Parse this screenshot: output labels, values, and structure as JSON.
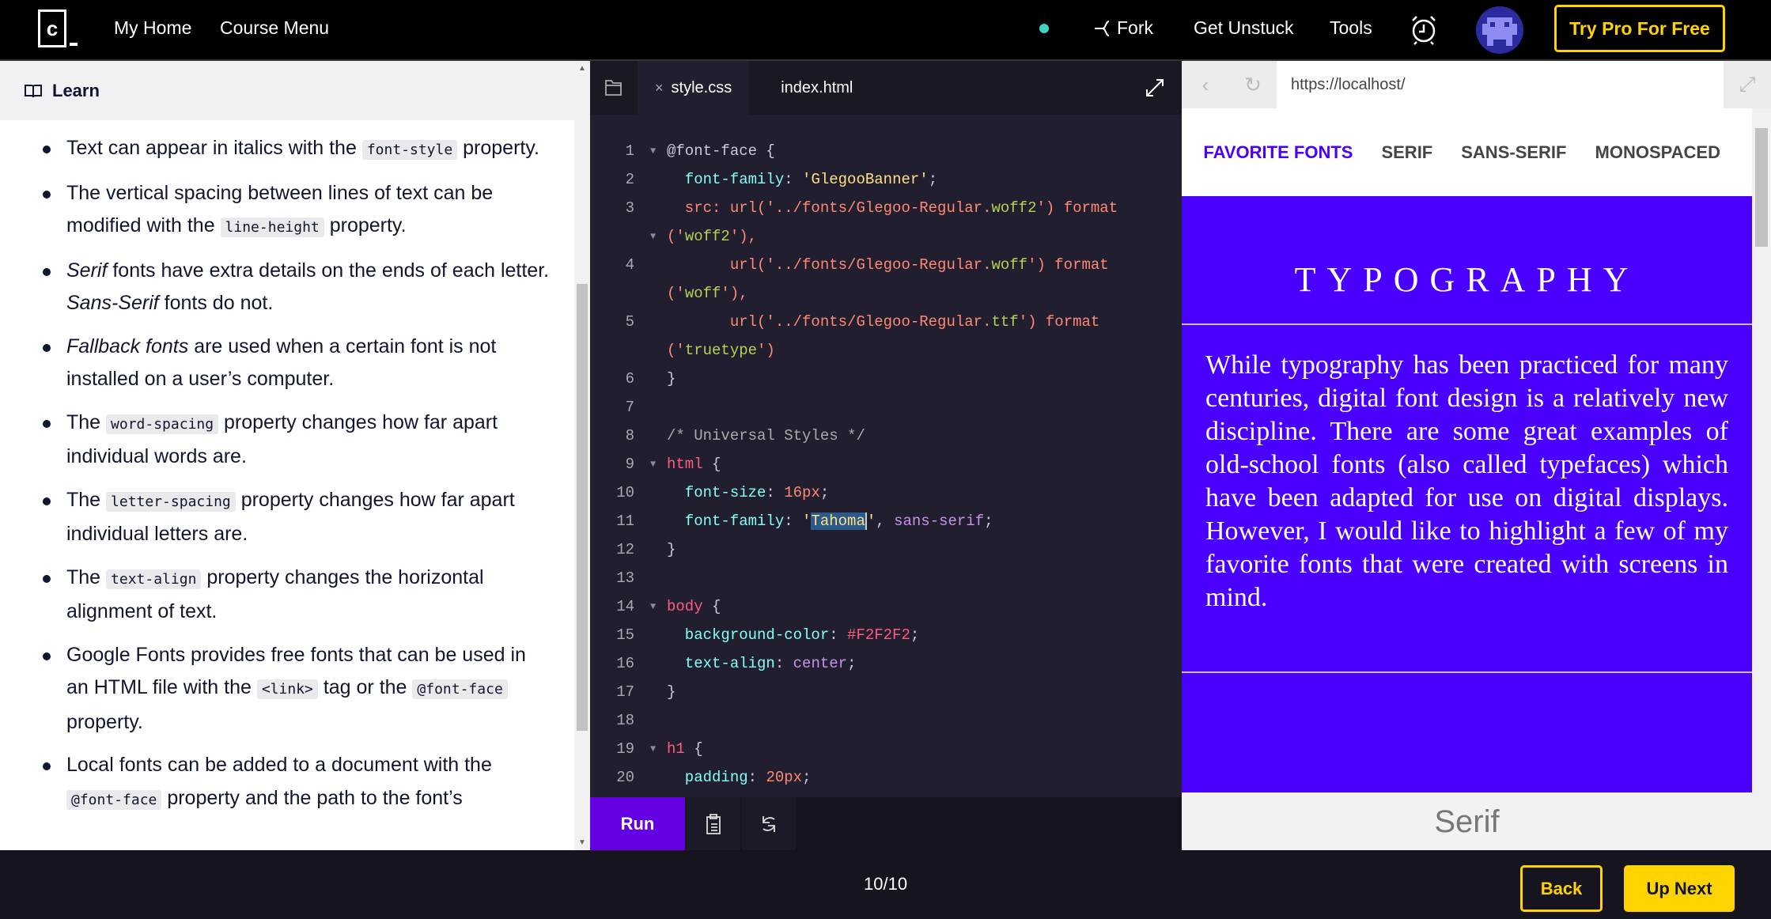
{
  "topbar": {
    "logo_letter": "c",
    "nav": [
      "My Home",
      "Course Menu"
    ],
    "fork": "Fork",
    "get_unstuck": "Get Unstuck",
    "tools": "Tools",
    "try_pro": "Try Pro For Free"
  },
  "learn": {
    "title": "Learn",
    "items": [
      [
        {
          "t": "text",
          "v": "Text can appear in italics with the "
        },
        {
          "t": "code",
          "v": "font-style"
        },
        {
          "t": "text",
          "v": " property."
        }
      ],
      [
        {
          "t": "text",
          "v": "The vertical spacing between lines of text can be modified with the "
        },
        {
          "t": "code",
          "v": "line-height"
        },
        {
          "t": "text",
          "v": " property."
        }
      ],
      [
        {
          "t": "em",
          "v": "Serif"
        },
        {
          "t": "text",
          "v": " fonts have extra details on the ends of each letter. "
        },
        {
          "t": "em",
          "v": "Sans-Serif"
        },
        {
          "t": "text",
          "v": " fonts do not."
        }
      ],
      [
        {
          "t": "em",
          "v": "Fallback fonts"
        },
        {
          "t": "text",
          "v": " are used when a certain font is not installed on a user’s computer."
        }
      ],
      [
        {
          "t": "text",
          "v": "The "
        },
        {
          "t": "code",
          "v": "word-spacing"
        },
        {
          "t": "text",
          "v": " property changes how far apart individual words are."
        }
      ],
      [
        {
          "t": "text",
          "v": "The "
        },
        {
          "t": "code",
          "v": "letter-spacing"
        },
        {
          "t": "text",
          "v": " property changes how far apart individual letters are."
        }
      ],
      [
        {
          "t": "text",
          "v": "The "
        },
        {
          "t": "code",
          "v": "text-align"
        },
        {
          "t": "text",
          "v": " property changes the horizontal alignment of text."
        }
      ],
      [
        {
          "t": "text",
          "v": "Google Fonts provides free fonts that can be used in an HTML file with the "
        },
        {
          "t": "code",
          "v": "<link>"
        },
        {
          "t": "text",
          "v": " tag or the "
        },
        {
          "t": "code",
          "v": "@font-face"
        },
        {
          "t": "text",
          "v": " property."
        }
      ],
      [
        {
          "t": "text",
          "v": "Local fonts can be added to a document with the "
        },
        {
          "t": "code",
          "v": "@font-face"
        },
        {
          "t": "text",
          "v": " property and the path to the font’s"
        }
      ]
    ]
  },
  "editor": {
    "tabs": [
      "style.css",
      "index.html"
    ],
    "active_tab": "style.css",
    "rows": [
      {
        "n": "1",
        "fold": true,
        "seg": [
          [
            "at",
            "@font-face "
          ],
          [
            "at",
            "{"
          ]
        ]
      },
      {
        "n": "2",
        "seg": [
          [
            "prop",
            "  font-family"
          ],
          [
            "at",
            ": "
          ],
          [
            "str",
            "'GlegooBanner'"
          ],
          [
            "at",
            ";"
          ]
        ]
      },
      {
        "n": "3",
        "seg": [
          [
            "url",
            "  src: url('../fonts/Glegoo-Regular."
          ],
          [
            "kw",
            "woff2"
          ],
          [
            "url",
            "') format"
          ]
        ]
      },
      {
        "n": "",
        "fold": true,
        "seg": [
          [
            "url",
            "('"
          ],
          [
            "kw",
            "woff2"
          ],
          [
            "url",
            "'),"
          ]
        ]
      },
      {
        "n": "4",
        "seg": [
          [
            "url",
            "       url('../fonts/Glegoo-Regular."
          ],
          [
            "kw",
            "woff"
          ],
          [
            "url",
            "') format"
          ]
        ]
      },
      {
        "n": "",
        "seg": [
          [
            "url",
            "('"
          ],
          [
            "kw",
            "woff"
          ],
          [
            "url",
            "'),"
          ]
        ]
      },
      {
        "n": "5",
        "seg": [
          [
            "url",
            "       url('../fonts/Glegoo-Regular."
          ],
          [
            "kw",
            "ttf"
          ],
          [
            "url",
            "') format"
          ]
        ]
      },
      {
        "n": "",
        "seg": [
          [
            "url",
            "('"
          ],
          [
            "kw",
            "truetype"
          ],
          [
            "url",
            "')"
          ]
        ]
      },
      {
        "n": "6",
        "seg": [
          [
            "at",
            "}"
          ]
        ]
      },
      {
        "n": "7",
        "seg": []
      },
      {
        "n": "8",
        "seg": [
          [
            "com",
            "/* Universal Styles */"
          ]
        ]
      },
      {
        "n": "9",
        "fold": true,
        "seg": [
          [
            "sel",
            "html"
          ],
          [
            "at",
            " {"
          ]
        ]
      },
      {
        "n": "10",
        "seg": [
          [
            "prop",
            "  font-size"
          ],
          [
            "at",
            ": "
          ],
          [
            "num",
            "16px"
          ],
          [
            "at",
            ";"
          ]
        ]
      },
      {
        "n": "11",
        "seg": [
          [
            "prop",
            "  font-family"
          ],
          [
            "at",
            ": "
          ],
          [
            "str",
            "'"
          ],
          [
            "strsel",
            "Tahoma"
          ],
          [
            "str",
            "'"
          ],
          [
            "at",
            ", "
          ],
          [
            "val",
            "sans-serif"
          ],
          [
            "at",
            ";"
          ]
        ]
      },
      {
        "n": "12",
        "seg": [
          [
            "at",
            "}"
          ]
        ]
      },
      {
        "n": "13",
        "seg": []
      },
      {
        "n": "14",
        "fold": true,
        "seg": [
          [
            "sel",
            "body"
          ],
          [
            "at",
            " {"
          ]
        ]
      },
      {
        "n": "15",
        "seg": [
          [
            "prop",
            "  background-color"
          ],
          [
            "at",
            ": "
          ],
          [
            "hex",
            "#F2F2F2"
          ],
          [
            "at",
            ";"
          ]
        ]
      },
      {
        "n": "16",
        "seg": [
          [
            "prop",
            "  text-align"
          ],
          [
            "at",
            ": "
          ],
          [
            "val",
            "center"
          ],
          [
            "at",
            ";"
          ]
        ]
      },
      {
        "n": "17",
        "seg": [
          [
            "at",
            "}"
          ]
        ]
      },
      {
        "n": "18",
        "seg": []
      },
      {
        "n": "19",
        "fold": true,
        "seg": [
          [
            "sel",
            "h1"
          ],
          [
            "at",
            " {"
          ]
        ]
      },
      {
        "n": "20",
        "seg": [
          [
            "prop",
            "  padding"
          ],
          [
            "at",
            ": "
          ],
          [
            "num",
            "20px"
          ],
          [
            "at",
            ";"
          ]
        ]
      }
    ],
    "run_label": "Run"
  },
  "browser": {
    "url": "https://localhost/",
    "nav": [
      "FAVORITE FONTS",
      "SERIF",
      "SANS-SERIF",
      "MONOSPACED"
    ],
    "heading": "TYPOGRAPHY",
    "paragraph": "While typography has been practiced for many centuries, digital font design is a relatively new discipline. There are some great examples of old-school fonts (also called typefaces) which have been adapted for use on digital displays. However, I would like to highlight a few of my favorite fonts that were created with screens in mind.",
    "next_heading": "Serif",
    "accent_color": "#4a00ff"
  },
  "footer": {
    "progress": "10/10",
    "back": "Back",
    "up_next": "Up Next"
  }
}
